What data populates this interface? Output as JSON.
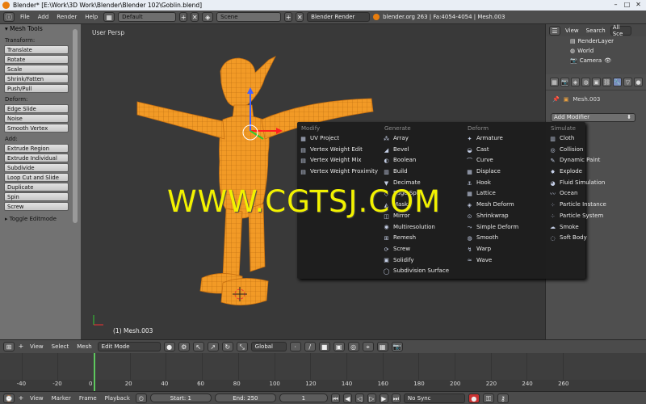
{
  "window": {
    "title": "Blender* [E:\\Work\\3D Work\\Blender\\Blender 102\\Goblin.blend]"
  },
  "info_header": {
    "menus": [
      "File",
      "Add",
      "Render",
      "Help"
    ],
    "screen_layout": "Default",
    "scene": "Scene",
    "render_engine": "Blender Render",
    "stats": "blender.org 263 | Fa:4054-4054 | Mesh.003"
  },
  "tool_shelf": {
    "title": "Mesh Tools",
    "sections": [
      {
        "label": "Transform:",
        "buttons": [
          "Translate",
          "Rotate",
          "Scale",
          "Shrink/Fatten",
          "Push/Pull"
        ]
      },
      {
        "label": "Deform:",
        "buttons": [
          "Edge Slide",
          "Noise",
          "Smooth Vertex"
        ]
      },
      {
        "label": "Add:",
        "buttons": [
          "Extrude Region",
          "Extrude Individual",
          "Subdivide",
          "Loop Cut and Slide",
          "Duplicate",
          "Spin",
          "Screw"
        ]
      }
    ],
    "toggle": "Toggle Editmode"
  },
  "viewport": {
    "view_label": "User Persp",
    "object_label": "(1) Mesh.003"
  },
  "outliner": {
    "menus": [
      "View",
      "Search"
    ],
    "filter": "All Sce",
    "items": [
      "RenderLayer",
      "World",
      "Camera"
    ]
  },
  "properties": {
    "object": "Mesh.003",
    "add_modifier": "Add Modifier"
  },
  "modifier_menu": {
    "columns": [
      {
        "header": "Modify",
        "items": [
          {
            "label": "UV Project",
            "icon": "uv-icon"
          },
          {
            "label": "Vertex Weight Edit",
            "icon": "weight-icon"
          },
          {
            "label": "Vertex Weight Mix",
            "icon": "weight-icon"
          },
          {
            "label": "Vertex Weight Proximity",
            "icon": "weight-icon"
          }
        ]
      },
      {
        "header": "Generate",
        "items": [
          {
            "label": "Array",
            "icon": "array-icon"
          },
          {
            "label": "Bevel",
            "icon": "bevel-icon"
          },
          {
            "label": "Boolean",
            "icon": "boolean-icon"
          },
          {
            "label": "Build",
            "icon": "build-icon"
          },
          {
            "label": "Decimate",
            "icon": "decimate-icon"
          },
          {
            "label": "Edge Split",
            "icon": "edgesplit-icon"
          },
          {
            "label": "Mask",
            "icon": "mask-icon"
          },
          {
            "label": "Mirror",
            "icon": "mirror-icon"
          },
          {
            "label": "Multiresolution",
            "icon": "multires-icon"
          },
          {
            "label": "Remesh",
            "icon": "remesh-icon"
          },
          {
            "label": "Screw",
            "icon": "screw-icon"
          },
          {
            "label": "Solidify",
            "icon": "solidify-icon"
          },
          {
            "label": "Subdivision Surface",
            "icon": "subsurf-icon"
          }
        ]
      },
      {
        "header": "Deform",
        "items": [
          {
            "label": "Armature",
            "icon": "armature-icon"
          },
          {
            "label": "Cast",
            "icon": "cast-icon"
          },
          {
            "label": "Curve",
            "icon": "curve-icon"
          },
          {
            "label": "Displace",
            "icon": "displace-icon"
          },
          {
            "label": "Hook",
            "icon": "hook-icon"
          },
          {
            "label": "Lattice",
            "icon": "lattice-icon"
          },
          {
            "label": "Mesh Deform",
            "icon": "meshdeform-icon"
          },
          {
            "label": "Shrinkwrap",
            "icon": "shrinkwrap-icon"
          },
          {
            "label": "Simple Deform",
            "icon": "simpledeform-icon"
          },
          {
            "label": "Smooth",
            "icon": "smooth-icon"
          },
          {
            "label": "Warp",
            "icon": "warp-icon"
          },
          {
            "label": "Wave",
            "icon": "wave-icon"
          }
        ]
      },
      {
        "header": "Simulate",
        "items": [
          {
            "label": "Cloth",
            "icon": "cloth-icon"
          },
          {
            "label": "Collision",
            "icon": "collision-icon"
          },
          {
            "label": "Dynamic Paint",
            "icon": "paint-icon"
          },
          {
            "label": "Explode",
            "icon": "explode-icon"
          },
          {
            "label": "Fluid Simulation",
            "icon": "fluid-icon"
          },
          {
            "label": "Ocean",
            "icon": "ocean-icon"
          },
          {
            "label": "Particle Instance",
            "icon": "particle-icon"
          },
          {
            "label": "Particle System",
            "icon": "particle-icon"
          },
          {
            "label": "Smoke",
            "icon": "smoke-icon"
          },
          {
            "label": "Soft Body",
            "icon": "softbody-icon"
          }
        ]
      }
    ]
  },
  "watermark": "WWW.CGTSJ.COM",
  "viewport_header": {
    "menus": [
      "View",
      "Select",
      "Mesh"
    ],
    "mode": "Edit Mode",
    "orientation": "Global"
  },
  "timeline": {
    "ticks": [
      "-40",
      "-20",
      "0",
      "20",
      "40",
      "60",
      "80",
      "100",
      "120",
      "140",
      "160",
      "180",
      "200",
      "220",
      "240",
      "260"
    ],
    "current_frame": 1
  },
  "timeline_header": {
    "menus": [
      "View",
      "Marker",
      "Frame",
      "Playback"
    ],
    "start": "Start: 1",
    "end": "End: 250",
    "current": "1",
    "sync": "No Sync"
  },
  "colors": {
    "mesh": "#f39a22",
    "accent_menu": "#1e1e1e",
    "watermark": "#f2f200",
    "frame_cursor": "#5ec85e"
  }
}
